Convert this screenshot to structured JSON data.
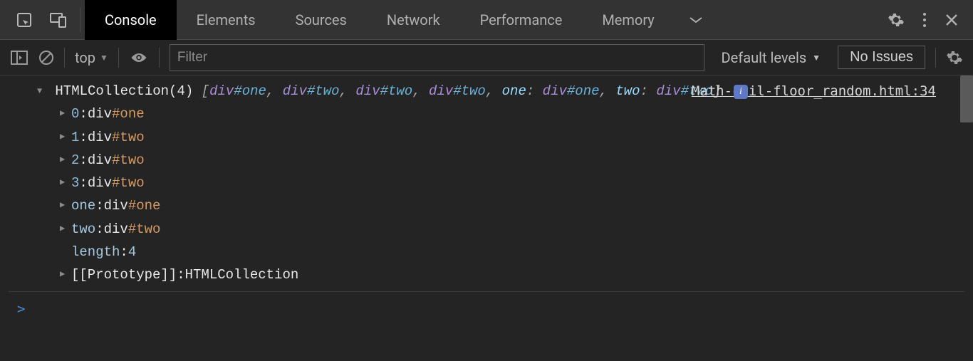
{
  "tabs": {
    "items": [
      "Console",
      "Elements",
      "Sources",
      "Network",
      "Performance",
      "Memory"
    ],
    "active_index": 0
  },
  "toolbar": {
    "context": "top",
    "filter_placeholder": "Filter",
    "levels_label": "Default levels",
    "issues_label": "No Issues"
  },
  "source_link": "Math-ceil-floor_random.html:34",
  "log": {
    "type_name": "HTMLCollection",
    "count_label": "(4)",
    "summary_items": [
      {
        "tag": "div",
        "id": "#one"
      },
      {
        "tag": "div",
        "id": "#two"
      },
      {
        "tag": "div",
        "id": "#two"
      },
      {
        "tag": "div",
        "id": "#two"
      }
    ],
    "summary_named": [
      {
        "key": "one",
        "tag": "div",
        "id": "#one"
      },
      {
        "key": "two",
        "tag": "div",
        "id": "#two"
      }
    ],
    "entries": [
      {
        "kind": "idx",
        "key": "0",
        "tag": "div",
        "id": "#one"
      },
      {
        "kind": "idx",
        "key": "1",
        "tag": "div",
        "id": "#two"
      },
      {
        "kind": "idx",
        "key": "2",
        "tag": "div",
        "id": "#two"
      },
      {
        "kind": "idx",
        "key": "3",
        "tag": "div",
        "id": "#two"
      },
      {
        "kind": "named",
        "key": "one",
        "tag": "div",
        "id": "#one"
      },
      {
        "kind": "named",
        "key": "two",
        "tag": "div",
        "id": "#two"
      }
    ],
    "length_key": "length",
    "length_val": "4",
    "proto_key": "[[Prototype]]",
    "proto_val": "HTMLCollection"
  },
  "prompt": ">"
}
